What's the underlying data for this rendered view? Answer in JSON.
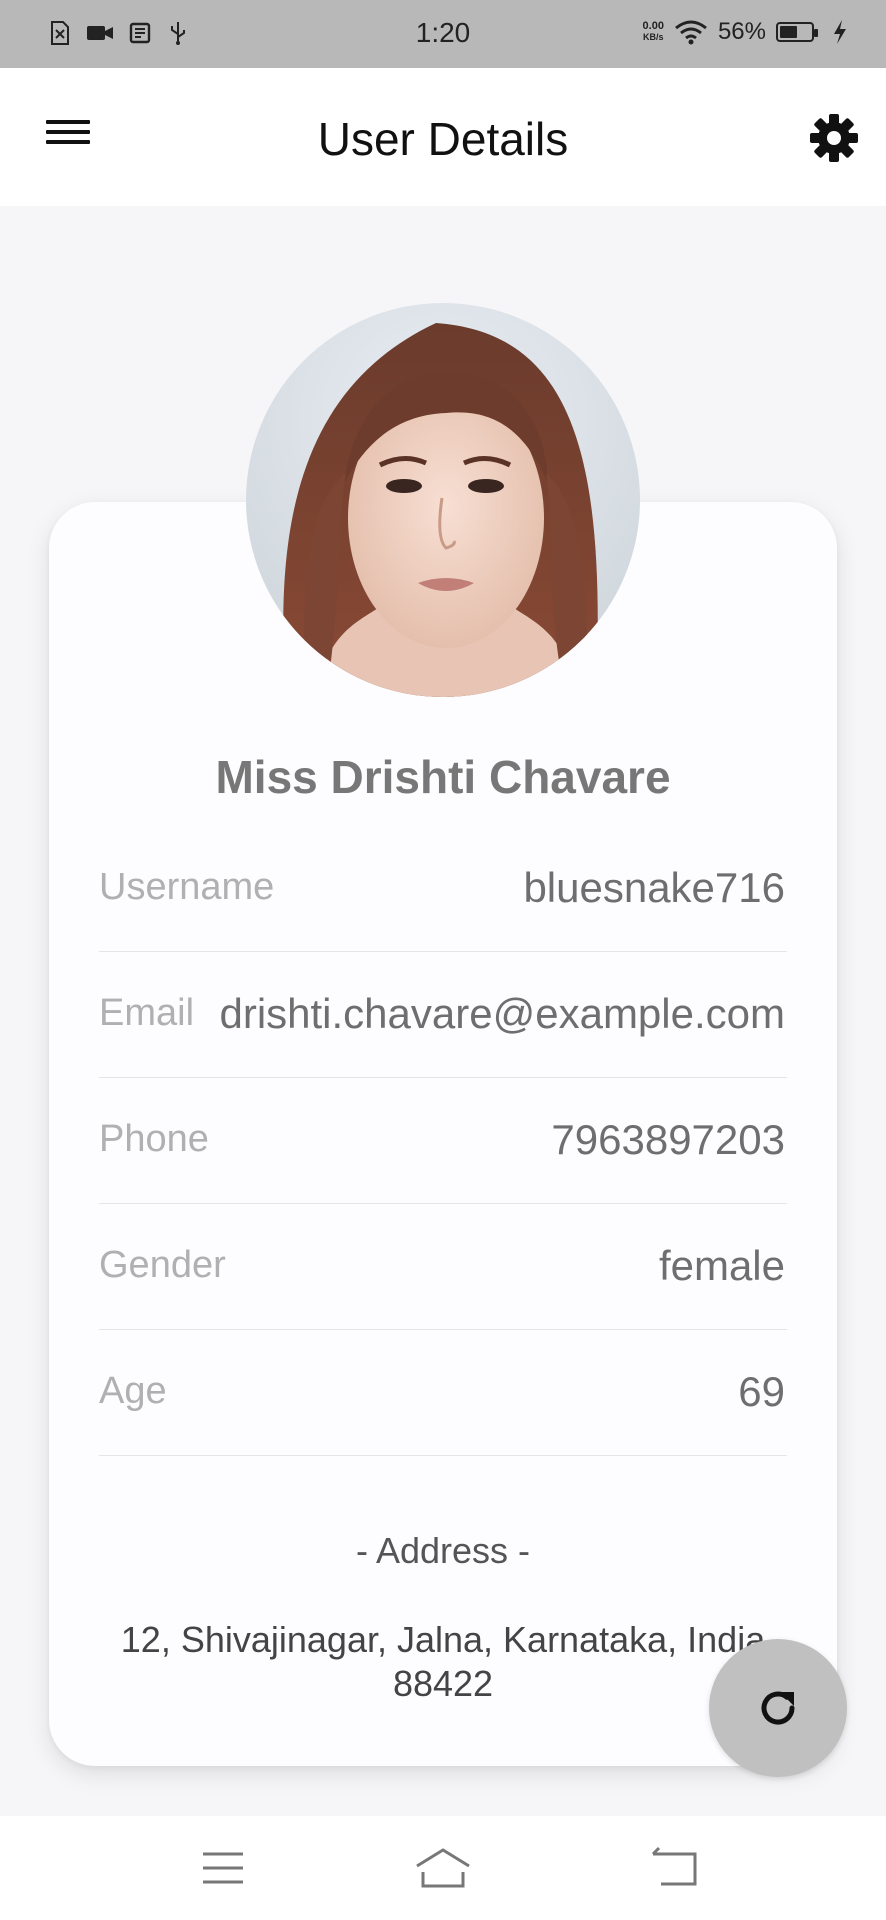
{
  "status_bar": {
    "time": "1:20",
    "net_speed_value": "0.00",
    "net_speed_unit": "KB/s",
    "battery_percent": "56%",
    "battery_level": 0.56,
    "left_icons": [
      "sim-error-icon",
      "video-camera-icon",
      "screenshot-icon",
      "usb-icon"
    ],
    "right_icons": [
      "wifi-icon",
      "battery-icon",
      "charging-bolt-icon"
    ]
  },
  "app_bar": {
    "title": "User Details",
    "menu_icon": "hamburger-menu-icon",
    "settings_icon": "gear-icon"
  },
  "profile": {
    "name": "Miss Drishti Chavare",
    "avatar": "profile-photo",
    "details": [
      {
        "label": "Username",
        "value": "bluesnake716"
      },
      {
        "label": "Email",
        "value": "drishti.chavare@example.com"
      },
      {
        "label": "Phone",
        "value": "7963897203"
      },
      {
        "label": "Gender",
        "value": "female"
      },
      {
        "label": "Age",
        "value": "69"
      }
    ],
    "address_heading": "- Address -",
    "address_line1": "12, Shivajinagar, Jalna, Karnataka, India",
    "address_line2": "88422"
  },
  "fab": {
    "icon": "refresh-icon"
  },
  "nav_bar": {
    "icons": [
      "recent-apps-icon",
      "home-icon",
      "back-icon"
    ]
  },
  "colors": {
    "status_bar_bg": "#b8b8b8",
    "page_bg": "#f6f6f8",
    "card_bg": "#fdfcfe",
    "fab_bg": "#c0c0c0"
  }
}
